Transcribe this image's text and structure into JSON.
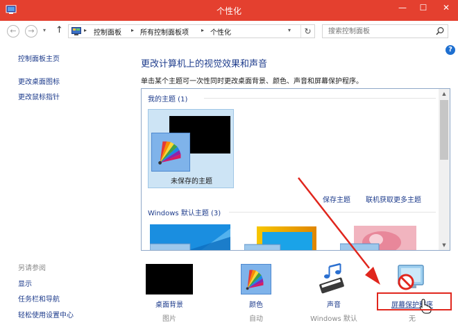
{
  "window": {
    "title": "个性化",
    "minimize": "—",
    "maximize": "☐",
    "close": "✕"
  },
  "nav": {
    "back": "←",
    "forward": "→",
    "recent": "▾",
    "up": "↑",
    "refresh": "↻",
    "breadcrumb": [
      "控制面板",
      "所有控制面板项",
      "个性化"
    ],
    "breadcrumb_sep": "▸",
    "dropdown": "▾"
  },
  "search": {
    "placeholder": "搜索控制面板"
  },
  "sidebar": {
    "home": "控制面板主页",
    "items": [
      "更改桌面图标",
      "更改鼠标指针"
    ],
    "see_also_header": "另请参阅",
    "see_also": [
      "显示",
      "任务栏和导航",
      "轻松使用设置中心"
    ]
  },
  "main": {
    "help": "?",
    "heading": "更改计算机上的视觉效果和声音",
    "description": "单击某个主题可一次性同时更改桌面背景、颜色、声音和屏幕保护程序。",
    "my_themes_label": "我的主题 (1)",
    "unsaved_theme": "未保存的主题",
    "save_theme_link": "保存主题",
    "get_more_link": "联机获取更多主题",
    "windows_themes_label": "Windows 默认主题 (3)"
  },
  "bottom": [
    {
      "label": "桌面背景",
      "value": "图片"
    },
    {
      "label": "颜色",
      "value": "自动"
    },
    {
      "label": "声音",
      "value": "Windows 默认"
    },
    {
      "label": "屏幕保护程序",
      "value": "无"
    }
  ],
  "colors": {
    "titlebar": "#e4402f",
    "link": "#1e3c8c",
    "selection": "#cde4f5",
    "annotation": "#e0261d"
  },
  "icons": {
    "app": "personalize-monitor-icon",
    "search": "magnifier-icon",
    "help": "question-icon",
    "sound": "music-notes-icon",
    "screensaver": "no-symbol-icon"
  }
}
